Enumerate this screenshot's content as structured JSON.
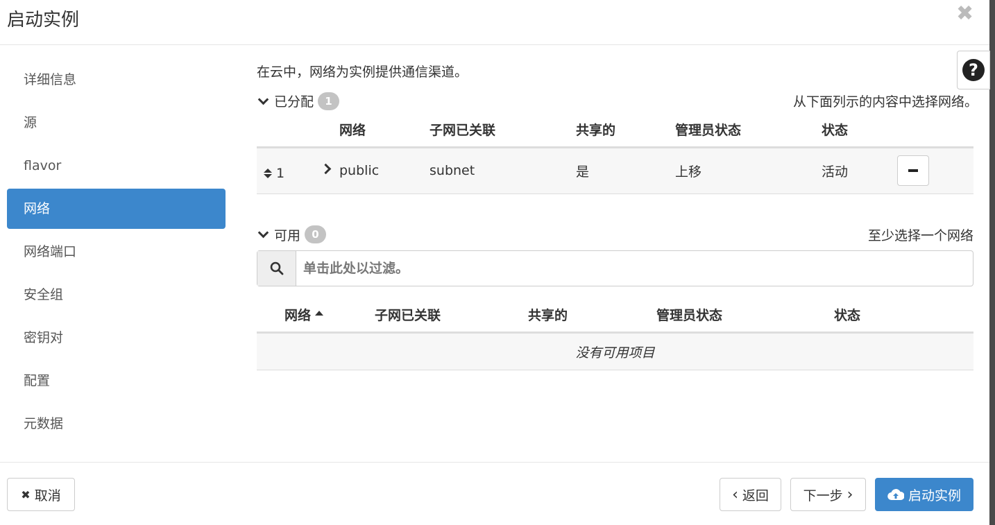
{
  "header": {
    "title": "启动实例",
    "close_glyph": "✖"
  },
  "help": {
    "glyph": "?"
  },
  "nav": {
    "items": [
      {
        "label": "详细信息",
        "active": false
      },
      {
        "label": "源",
        "active": false
      },
      {
        "label": "flavor",
        "active": false
      },
      {
        "label": "网络",
        "active": true
      },
      {
        "label": "网络端口",
        "active": false
      },
      {
        "label": "安全组",
        "active": false
      },
      {
        "label": "密钥对",
        "active": false
      },
      {
        "label": "配置",
        "active": false
      },
      {
        "label": "元数据",
        "active": false
      }
    ]
  },
  "main": {
    "description": "在云中，网络为实例提供通信渠道。",
    "allocated": {
      "label": "已分配",
      "count": "1",
      "hint": "从下面列示的内容中选择网络。",
      "columns": [
        "网络",
        "子网已关联",
        "共享的",
        "管理员状态",
        "状态"
      ],
      "rows": [
        {
          "order": "1",
          "network": "public",
          "subnet": "subnet",
          "shared": "是",
          "admin_state": "上移",
          "status": "活动"
        }
      ]
    },
    "available": {
      "label": "可用",
      "count": "0",
      "hint": "至少选择一个网络",
      "filter_placeholder": "单击此处以过滤。",
      "columns": [
        "网络",
        "子网已关联",
        "共享的",
        "管理员状态",
        "状态"
      ],
      "empty_text": "没有可用项目"
    }
  },
  "footer": {
    "cancel_label": "取消",
    "cancel_glyph": "✖",
    "back_label": "返回",
    "back_glyph": "‹",
    "next_label": "下一步",
    "next_glyph": "›",
    "launch_label": "启动实例"
  },
  "colors": {
    "accent": "#3c87cc",
    "badge": "#c3c3c3"
  }
}
